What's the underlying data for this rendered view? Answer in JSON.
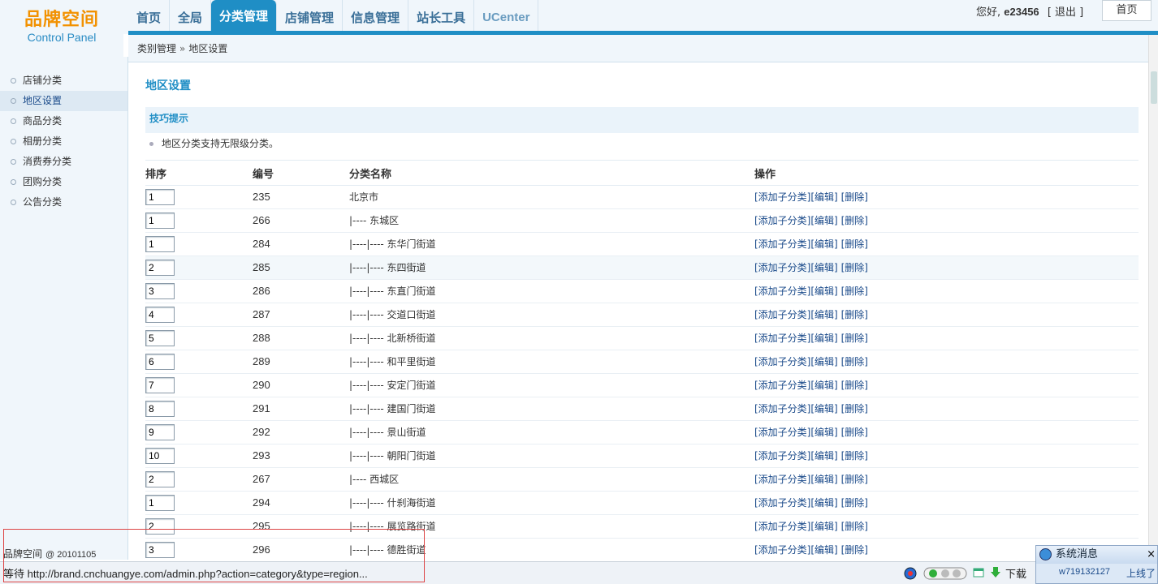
{
  "logo": {
    "brand": "品牌空间",
    "subtitle": "Control Panel"
  },
  "nav": {
    "tabs": [
      {
        "label": "首页",
        "active": false
      },
      {
        "label": "全局",
        "active": false
      },
      {
        "label": "分类管理",
        "active": true
      },
      {
        "label": "店铺管理",
        "active": false
      },
      {
        "label": "信息管理",
        "active": false
      },
      {
        "label": "站长工具",
        "active": false
      },
      {
        "label": "UCenter",
        "active": false
      }
    ]
  },
  "user": {
    "greeting": "您好,",
    "name": "e23456",
    "logout": "[ 退出 ]",
    "home_button": "首页"
  },
  "breadcrumb": {
    "parent": "类别管理",
    "sep": "»",
    "current": "地区设置"
  },
  "sidebar": {
    "items": [
      {
        "label": "店铺分类"
      },
      {
        "label": "地区设置"
      },
      {
        "label": "商品分类"
      },
      {
        "label": "相册分类"
      },
      {
        "label": "消费券分类"
      },
      {
        "label": "团购分类"
      },
      {
        "label": "公告分类"
      }
    ],
    "active_index": 1
  },
  "footer": {
    "brand": "品牌空间",
    "version": "@ 20101105"
  },
  "main": {
    "title": "地区设置",
    "tips_title": "技巧提示",
    "tips_text": "地区分类支持无限级分类。",
    "table": {
      "headers": [
        "排序",
        "编号",
        "分类名称",
        "操作"
      ],
      "actions": {
        "add": "[添加子分类]",
        "edit": "[编辑]",
        "delete": "[删除]"
      },
      "rows": [
        {
          "order": "1",
          "id": "235",
          "name": "北京市"
        },
        {
          "order": "1",
          "id": "266",
          "name": "|---- 东城区"
        },
        {
          "order": "1",
          "id": "284",
          "name": "|----|---- 东华门街道"
        },
        {
          "order": "2",
          "id": "285",
          "name": "|----|---- 东四街道"
        },
        {
          "order": "3",
          "id": "286",
          "name": "|----|---- 东直门街道"
        },
        {
          "order": "4",
          "id": "287",
          "name": "|----|---- 交道口街道"
        },
        {
          "order": "5",
          "id": "288",
          "name": "|----|---- 北新桥街道"
        },
        {
          "order": "6",
          "id": "289",
          "name": "|----|---- 和平里街道"
        },
        {
          "order": "7",
          "id": "290",
          "name": "|----|---- 安定门街道"
        },
        {
          "order": "8",
          "id": "291",
          "name": "|----|---- 建国门街道"
        },
        {
          "order": "9",
          "id": "292",
          "name": "|----|---- 景山街道"
        },
        {
          "order": "10",
          "id": "293",
          "name": "|----|---- 朝阳门街道"
        },
        {
          "order": "2",
          "id": "267",
          "name": "|---- 西城区"
        },
        {
          "order": "1",
          "id": "294",
          "name": "|----|---- 什刹海街道"
        },
        {
          "order": "2",
          "id": "295",
          "name": "|----|---- 展览路街道"
        },
        {
          "order": "3",
          "id": "296",
          "name": "|----|---- 德胜街道"
        }
      ],
      "highlighted_row": 3
    }
  },
  "statusbar": {
    "text": "等待 http://brand.cnchuangye.com/admin.php?action=category&type=region...",
    "download_label": "下载"
  },
  "notification": {
    "title": "系统消息",
    "close": "×",
    "user": "w719132127",
    "online": "上线了"
  },
  "colors": {
    "accent": "#1f8ec5",
    "brand": "#f29100",
    "sidebar_bg": "#f0f6fb",
    "link": "#1a4a8a"
  }
}
